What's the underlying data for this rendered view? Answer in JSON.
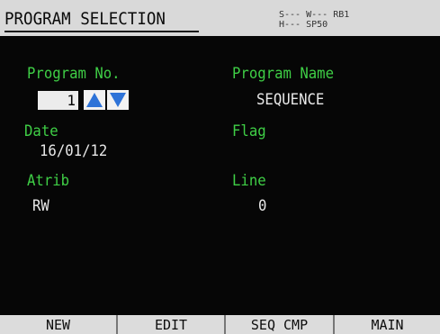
{
  "header": {
    "title": "PROGRAM SELECTION",
    "status_line1": "S--- W--- RB1",
    "status_line2": "H---      SP50"
  },
  "program_no": {
    "label": "Program No.",
    "value": "1"
  },
  "program_name": {
    "label": "Program Name",
    "value": "SEQUENCE"
  },
  "date": {
    "label": "Date",
    "value": "16/01/12"
  },
  "flag": {
    "label": "Flag",
    "value": ""
  },
  "atrib": {
    "label": "Atrib",
    "value": "RW"
  },
  "line": {
    "label": "Line",
    "value": "0"
  },
  "softkeys": [
    {
      "label": "NEW"
    },
    {
      "label": "EDIT"
    },
    {
      "label": "SEQ CMP"
    },
    {
      "label": "MAIN"
    }
  ],
  "colors": {
    "label_green": "#3fcf46",
    "value_white": "#e8e8e8",
    "arrow_blue": "#2e73d8"
  }
}
